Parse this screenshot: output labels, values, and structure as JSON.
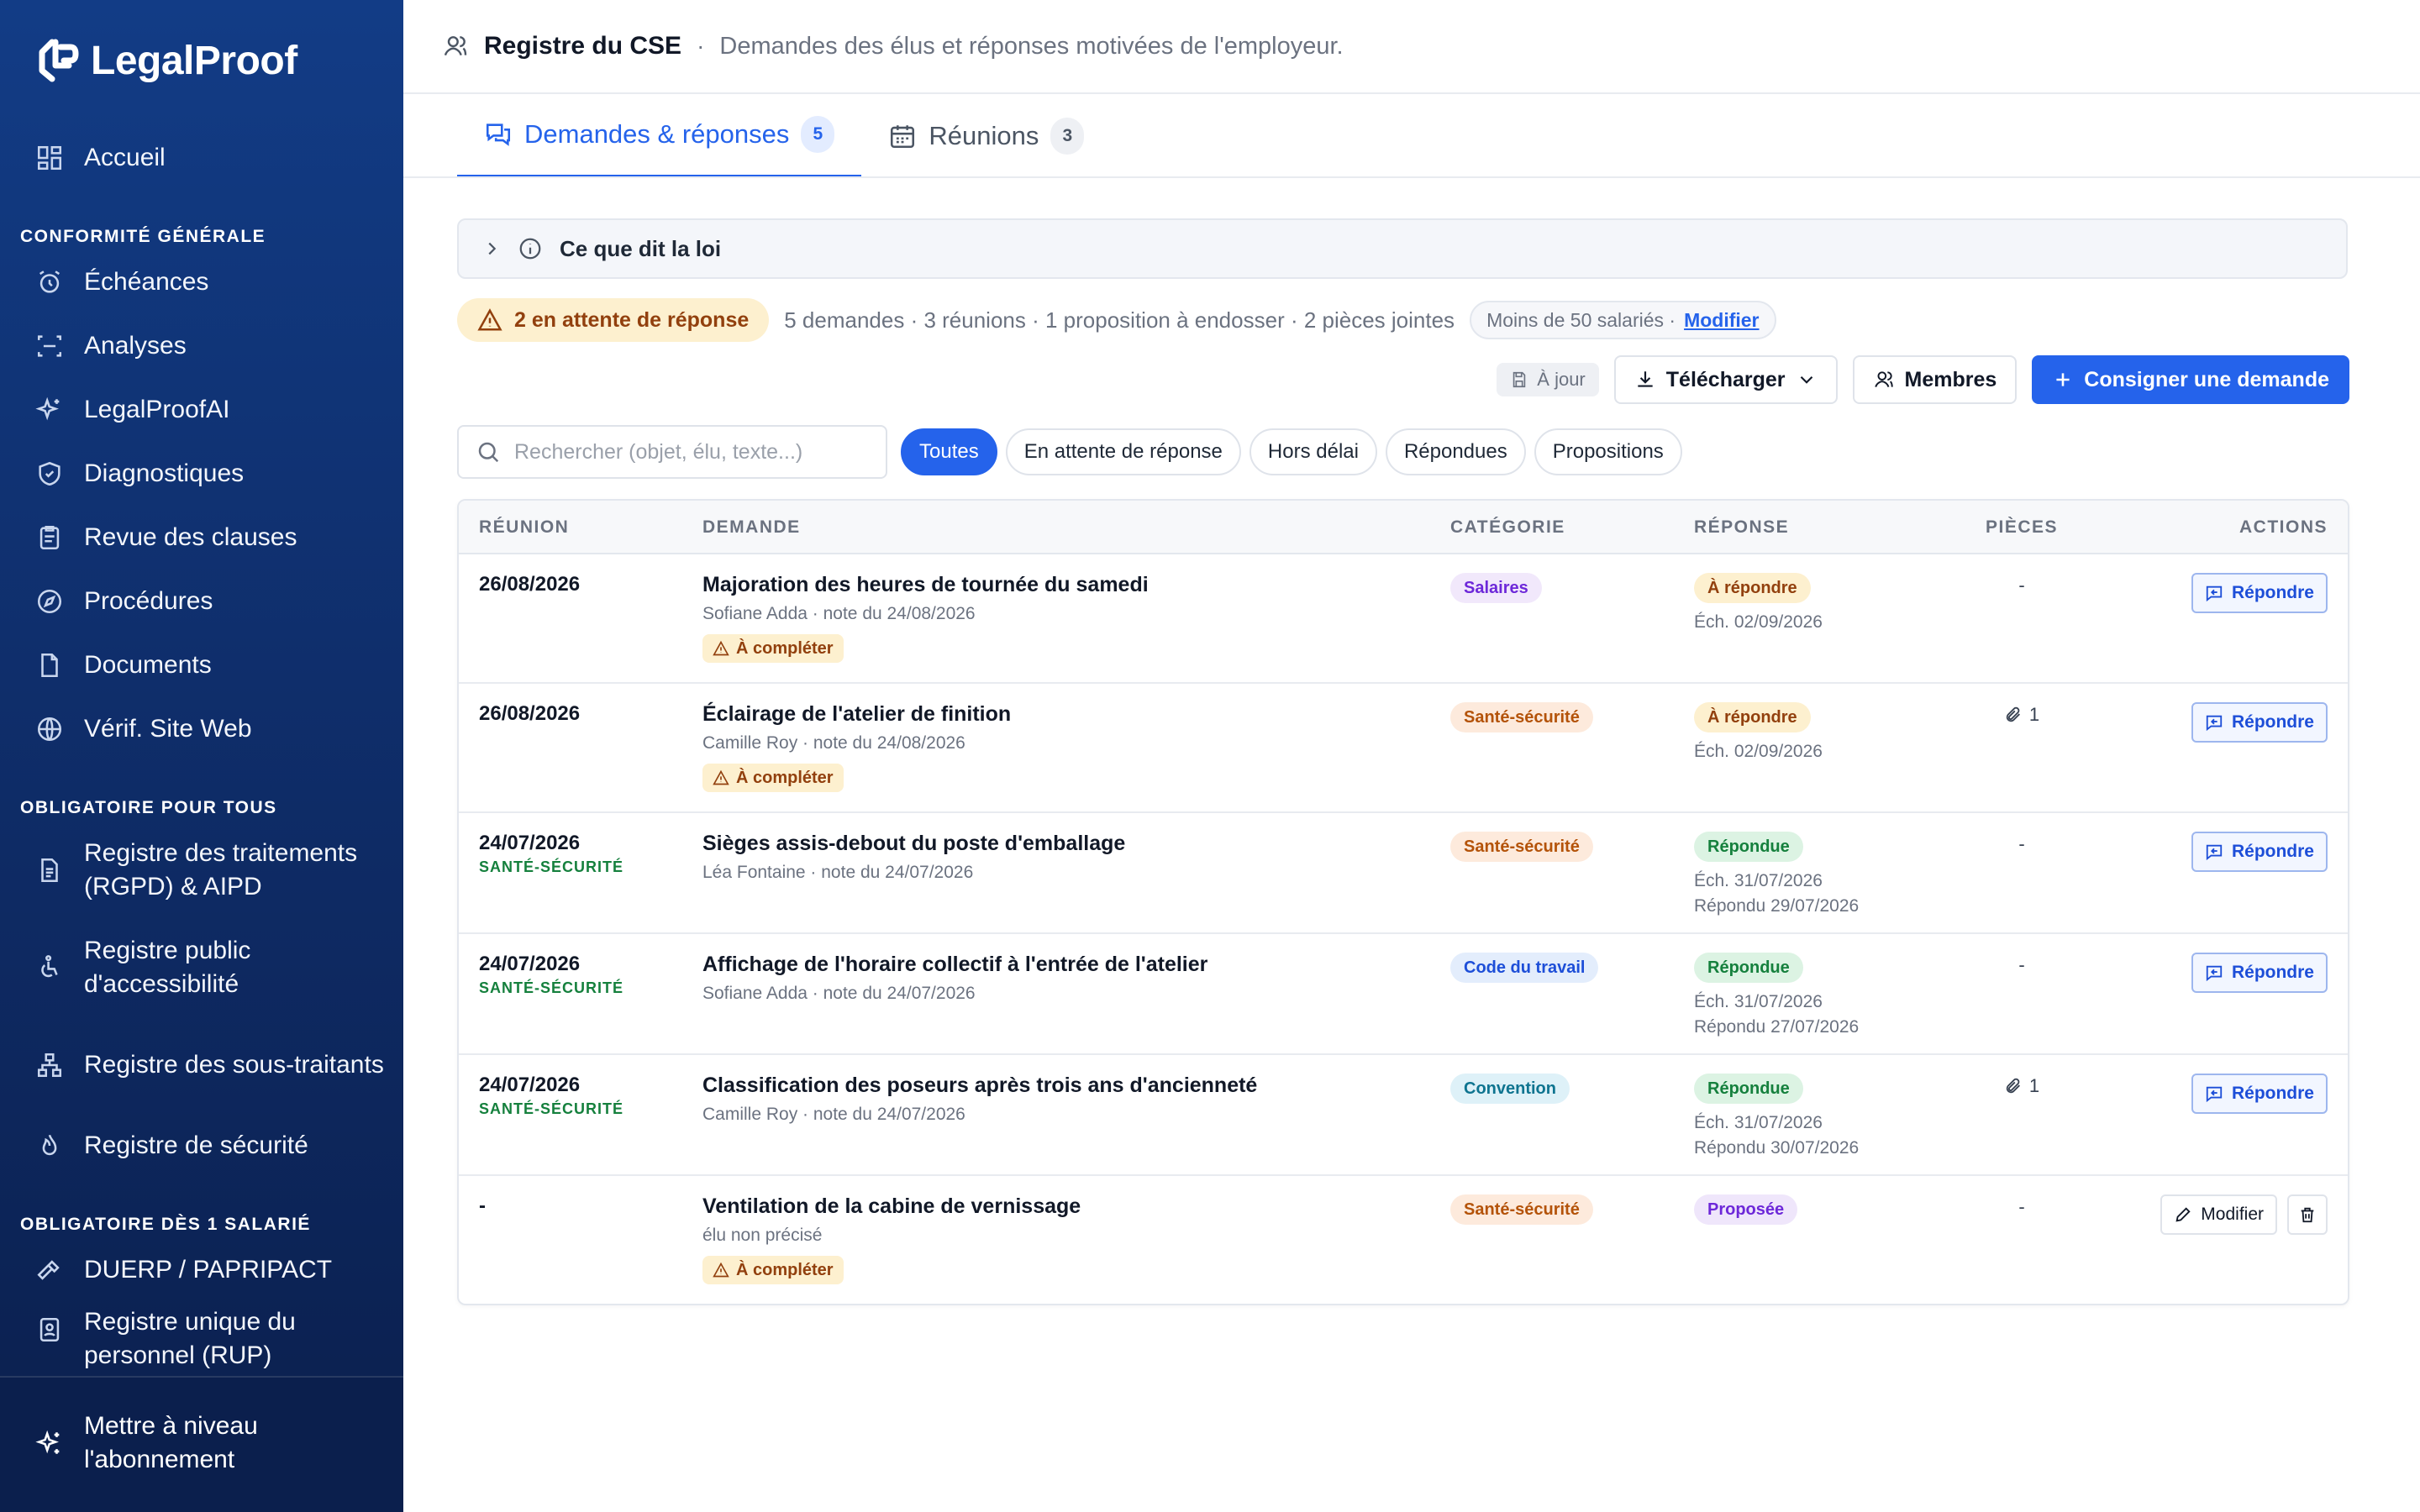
{
  "app": {
    "name": "LegalProof"
  },
  "sidebar": {
    "home": "Accueil",
    "sections": [
      {
        "title": "CONFORMITÉ GÉNÉRALE",
        "items": [
          "Échéances",
          "Analyses",
          "LegalProofAI",
          "Diagnostiques",
          "Revue des clauses",
          "Procédures",
          "Documents",
          "Vérif. Site Web"
        ]
      },
      {
        "title": "OBLIGATOIRE POUR TOUS",
        "items": [
          "Registre des traitements (RGPD) & AIPD",
          "Registre public d'accessibilité",
          "Registre des sous-traitants",
          "Registre de sécurité"
        ]
      },
      {
        "title": "OBLIGATOIRE DÈS 1 SALARIÉ",
        "items": [
          "DUERP / PAPRIPACT",
          "Registre unique du personnel (RUP)"
        ]
      }
    ],
    "upgrade": "Mettre à niveau l'abonnement"
  },
  "header": {
    "title": "Registre du CSE",
    "separator": "·",
    "subtitle": "Demandes des élus et réponses motivées de l'employeur."
  },
  "tabs": [
    {
      "label": "Demandes & réponses",
      "count": "5",
      "active": true
    },
    {
      "label": "Réunions",
      "count": "3",
      "active": false
    }
  ],
  "law_panel": {
    "label": "Ce que dit la loi"
  },
  "status": {
    "pending": "2 en attente de réponse",
    "stats": "5 demandes · 3 réunions · 1 proposition à endosser · 2 pièces jointes",
    "company_size": "Moins de 50 salariés ·",
    "modify": "Modifier"
  },
  "toolbar": {
    "sync": "À jour",
    "download": "Télécharger",
    "members": "Membres",
    "record": "Consigner une demande"
  },
  "search": {
    "placeholder": "Rechercher (objet, élu, texte...)",
    "value": ""
  },
  "filters": [
    "Toutes",
    "En attente de réponse",
    "Hors délai",
    "Répondues",
    "Propositions"
  ],
  "table": {
    "headers": {
      "meeting": "RÉUNION",
      "request": "DEMANDE",
      "category": "CATÉGORIE",
      "response": "RÉPONSE",
      "pieces": "PIÈCES",
      "actions": "ACTIONS"
    },
    "rows": [
      {
        "date": "26/08/2026",
        "date_tag": "",
        "title": "Majoration des heures de tournée du samedi",
        "meta": "Sofiane Adda · note du 24/08/2026",
        "warn": "À compléter",
        "category": "Salaires",
        "cat_class": "salaires",
        "status": "À répondre",
        "status_class": "todo",
        "due": "Éch. 02/09/2026",
        "answered": "",
        "pieces": "-",
        "attach": false,
        "action": "Répondre"
      },
      {
        "date": "26/08/2026",
        "date_tag": "",
        "title": "Éclairage de l'atelier de finition",
        "meta": "Camille Roy · note du 24/08/2026",
        "warn": "À compléter",
        "category": "Santé-sécurité",
        "cat_class": "sante",
        "status": "À répondre",
        "status_class": "todo",
        "due": "Éch. 02/09/2026",
        "answered": "",
        "pieces": "1",
        "attach": true,
        "action": "Répondre"
      },
      {
        "date": "24/07/2026",
        "date_tag": "SANTÉ-SÉCURITÉ",
        "title": "Sièges assis-debout du poste d'emballage",
        "meta": "Léa Fontaine · note du 24/07/2026",
        "warn": "",
        "category": "Santé-sécurité",
        "cat_class": "sante",
        "status": "Répondue",
        "status_class": "done",
        "due": "Éch. 31/07/2026",
        "answered": "Répondu 29/07/2026",
        "pieces": "-",
        "attach": false,
        "action": "Répondre"
      },
      {
        "date": "24/07/2026",
        "date_tag": "SANTÉ-SÉCURITÉ",
        "title": "Affichage de l'horaire collectif à l'entrée de l'atelier",
        "meta": "Sofiane Adda · note du 24/07/2026",
        "warn": "",
        "category": "Code du travail",
        "cat_class": "code",
        "status": "Répondue",
        "status_class": "done",
        "due": "Éch. 31/07/2026",
        "answered": "Répondu 27/07/2026",
        "pieces": "-",
        "attach": false,
        "action": "Répondre"
      },
      {
        "date": "24/07/2026",
        "date_tag": "SANTÉ-SÉCURITÉ",
        "title": "Classification des poseurs après trois ans d'ancienneté",
        "meta": "Camille Roy · note du 24/07/2026",
        "warn": "",
        "category": "Convention",
        "cat_class": "conv",
        "status": "Répondue",
        "status_class": "done",
        "due": "Éch. 31/07/2026",
        "answered": "Répondu 30/07/2026",
        "pieces": "1",
        "attach": true,
        "action": "Répondre"
      },
      {
        "date": "-",
        "date_tag": "",
        "title": "Ventilation de la cabine de vernissage",
        "meta": "élu non précisé",
        "warn": "À compléter",
        "category": "Santé-sécurité",
        "cat_class": "sante",
        "status": "Proposée",
        "status_class": "prop",
        "due": "",
        "answered": "",
        "pieces": "-",
        "attach": false,
        "action": "Modifier"
      }
    ]
  }
}
